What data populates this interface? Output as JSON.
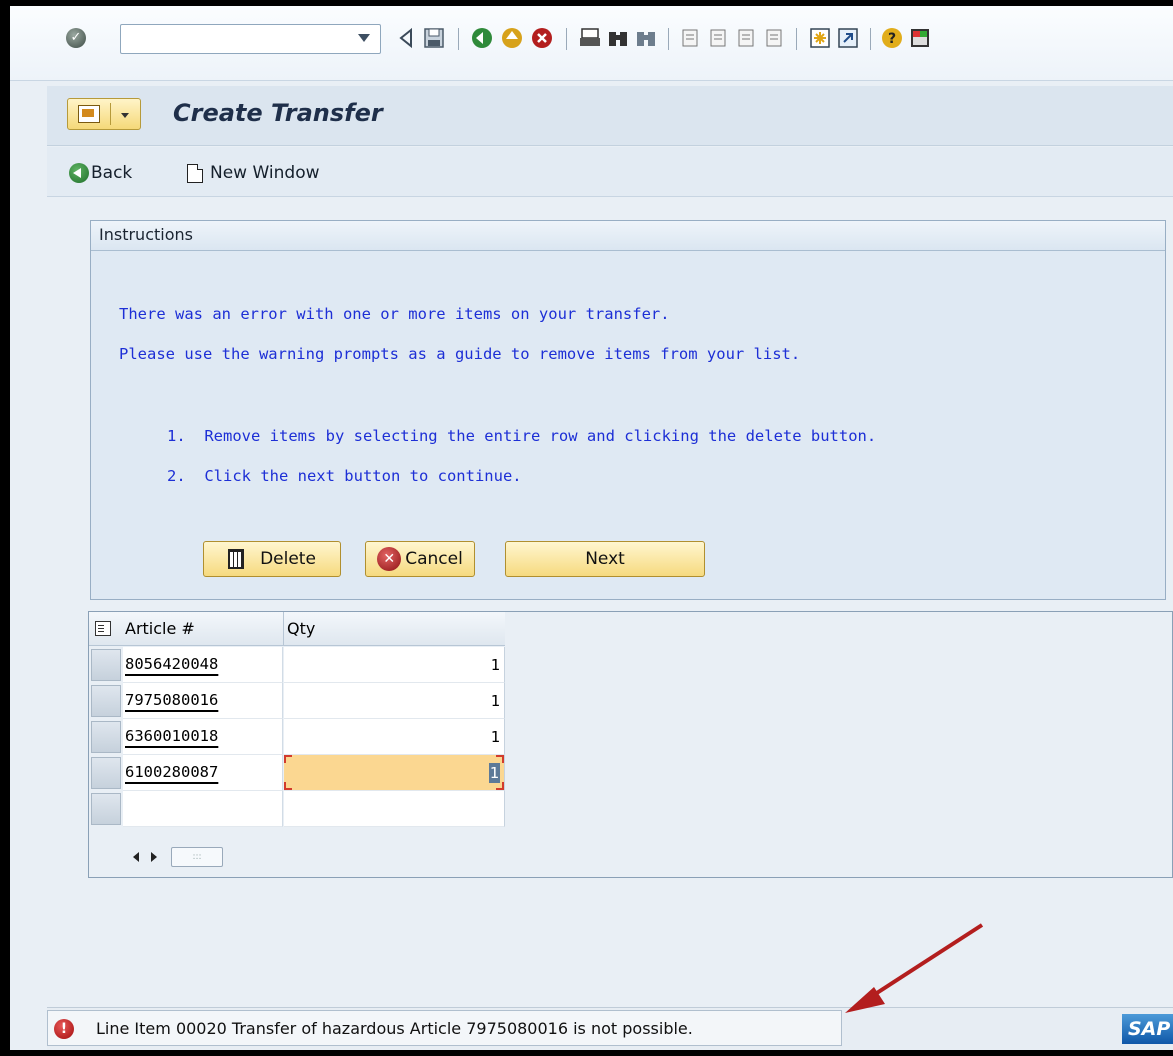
{
  "toolbar": {
    "command_field_value": "",
    "icons": [
      "enter-icon",
      "back-nav-icon",
      "save-icon",
      "back-icon",
      "exit-icon",
      "cancel-icon",
      "print-icon",
      "find-icon",
      "find-next-icon",
      "first-page-icon",
      "previous-page-icon",
      "next-page-icon",
      "last-page-icon",
      "create-session-icon",
      "shortcut-icon",
      "help-icon",
      "layout-menu-icon"
    ]
  },
  "title_bar": {
    "title": "Create Transfer"
  },
  "app_toolbar": {
    "back_label": "Back",
    "new_window_label": "New Window"
  },
  "instructions": {
    "header": "Instructions",
    "line1": "There was an error with one or more items on your transfer.",
    "line2": "Please use the warning prompts as a guide to remove items from your list.",
    "step1": "1.  Remove items by selecting the entire row and clicking the delete button.",
    "step2": "2.  Click the next button to continue.",
    "delete_label": "Delete",
    "cancel_label": "Cancel",
    "next_label": "Next"
  },
  "table": {
    "columns": [
      "Article #",
      "Qty"
    ],
    "rows": [
      {
        "article": "8056420048",
        "qty": "1"
      },
      {
        "article": "7975080016",
        "qty": "1"
      },
      {
        "article": "6360010018",
        "qty": "1"
      },
      {
        "article": "6100280087",
        "qty": "1"
      }
    ]
  },
  "status": {
    "message": "Line Item 00020 Transfer of hazardous Article 7975080016 is not possible.",
    "logo": "SAP"
  },
  "colors": {
    "instruction_text": "#1d2fd6",
    "button_bg": "#f6da7f",
    "active_cell": "#fbd791",
    "annotation_arrow": "#b31e1e"
  }
}
